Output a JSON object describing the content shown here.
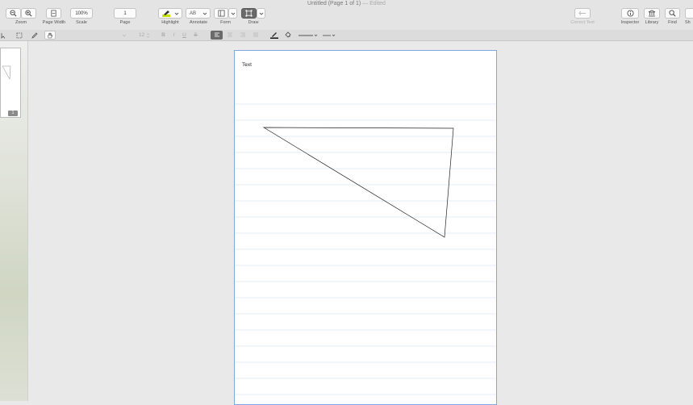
{
  "window": {
    "title": "Untitled (Page 1 of 1)",
    "edited": "— Edited"
  },
  "toolbar": {
    "zoom_label": "Zoom",
    "page_width_label": "Page Width",
    "scale_value": "100%",
    "scale_label": "Scale",
    "page_value": "1",
    "page_label": "Page",
    "highlight_label": "Highlight",
    "annotate_text": "AB",
    "annotate_label": "Annotate",
    "form_label": "Form",
    "draw_label": "Draw",
    "correct_text_label": "Correct Text",
    "inspector_label": "Inspector",
    "library_label": "Library",
    "find_label": "Find",
    "share_label": "Sh"
  },
  "format_bar": {
    "font_size": "12"
  },
  "sidebar": {
    "page_number": "1"
  },
  "document": {
    "text_label": "Text"
  },
  "colors": {
    "page_border": "#7ea9df",
    "rule_lines": "#d6e8f2",
    "highlight": "#c6e000",
    "accent_dark": "#6a6a6a"
  },
  "icons": [
    "zoom-out-icon",
    "zoom-in-icon",
    "page-width-icon",
    "highlighter-icon",
    "form-icon",
    "draw-icon",
    "correct-text-icon",
    "info-icon",
    "library-icon",
    "search-icon",
    "pointer-icon",
    "rect-select-icon",
    "pencil-icon",
    "hand-icon",
    "bold-icon",
    "italic-icon",
    "underline-icon",
    "strikethrough-icon",
    "align-left-icon",
    "align-center-icon",
    "align-right-icon",
    "justify-icon",
    "pen-color-icon",
    "fill-color-icon",
    "line-style-icon",
    "line-end-icon"
  ]
}
